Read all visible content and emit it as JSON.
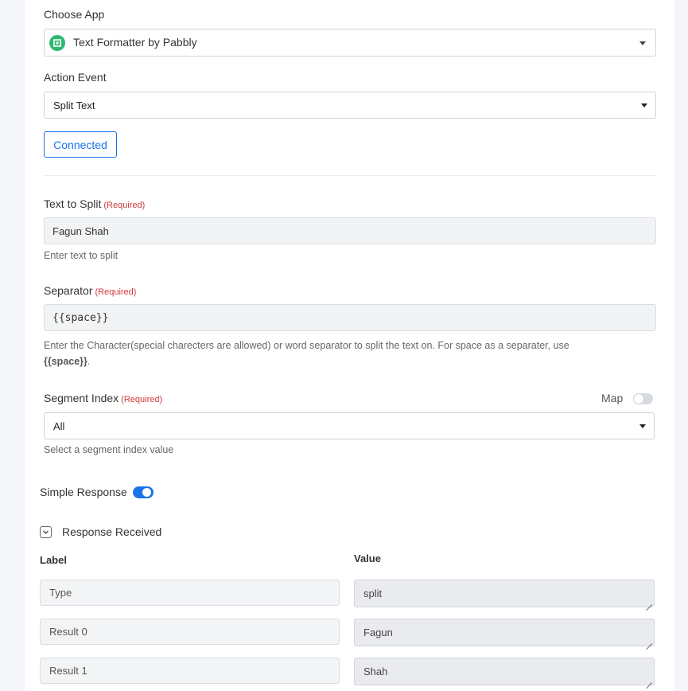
{
  "choose_app": {
    "label": "Choose App",
    "value": "Text Formatter by Pabbly"
  },
  "action_event": {
    "label": "Action Event",
    "value": "Split Text"
  },
  "connection": {
    "button_label": "Connected"
  },
  "text_to_split": {
    "label": "Text to Split",
    "required": "(Required)",
    "value": "Fagun Shah",
    "help": "Enter text to split"
  },
  "separator": {
    "label": "Separator",
    "required": "(Required)",
    "value": "{{space}}",
    "help_text": "Enter the Character(special charecters are allowed) or word separator to split the text on. For space as a separater, use",
    "help_code": "{{space}}",
    "help_end": "."
  },
  "segment_index": {
    "label": "Segment Index",
    "required": "(Required)",
    "map_label": "Map",
    "map_enabled": false,
    "value": "All",
    "help": "Select a segment index value"
  },
  "simple_response": {
    "label": "Simple Response",
    "enabled": true
  },
  "response": {
    "title": "Response Received",
    "label_header": "Label",
    "value_header": "Value",
    "rows": [
      {
        "label": "Type",
        "value": "split"
      },
      {
        "label": "Result 0",
        "value": "Fagun"
      },
      {
        "label": "Result 1",
        "value": "Shah"
      }
    ]
  },
  "colors": {
    "accent": "#1a73e8",
    "required": "#d23b3b",
    "app_icon": "#2eb872"
  }
}
